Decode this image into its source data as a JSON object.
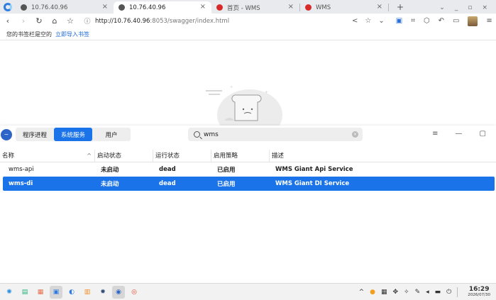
{
  "browser": {
    "tabs": [
      {
        "title": "10.76.40.96",
        "active": false
      },
      {
        "title": "10.76.40.96",
        "active": true
      },
      {
        "title": "首页 - WMS",
        "active": false
      },
      {
        "title": "WMS",
        "active": false
      }
    ],
    "url_host": "http://10.76.40.96",
    "url_path": ":8053/swagger/index.html",
    "bookmarks_empty_text": "您的书签栏是空的",
    "bookmarks_import_link": "立即导入书签"
  },
  "app": {
    "tabs": [
      {
        "label": "程序进程",
        "active": false
      },
      {
        "label": "系统服务",
        "active": true
      },
      {
        "label": "用户",
        "active": false
      }
    ],
    "search_value": "wms",
    "table": {
      "headers": [
        "名称",
        "启动状态",
        "运行状态",
        "启用策略",
        "描述"
      ],
      "rows": [
        {
          "name": "wms-api",
          "start": "未启动",
          "run": "dead",
          "policy": "已启用",
          "desc": "WMS Giant Api Service",
          "selected": false
        },
        {
          "name": "wms-di",
          "start": "未启动",
          "run": "dead",
          "policy": "已启用",
          "desc": "WMS Giant DI Service",
          "selected": true
        }
      ]
    }
  },
  "taskbar": {
    "time": "16:29",
    "date": "2026/07/30"
  },
  "colors": {
    "accent": "#1a73e8",
    "tab_icon_red": "#d92a2a"
  }
}
